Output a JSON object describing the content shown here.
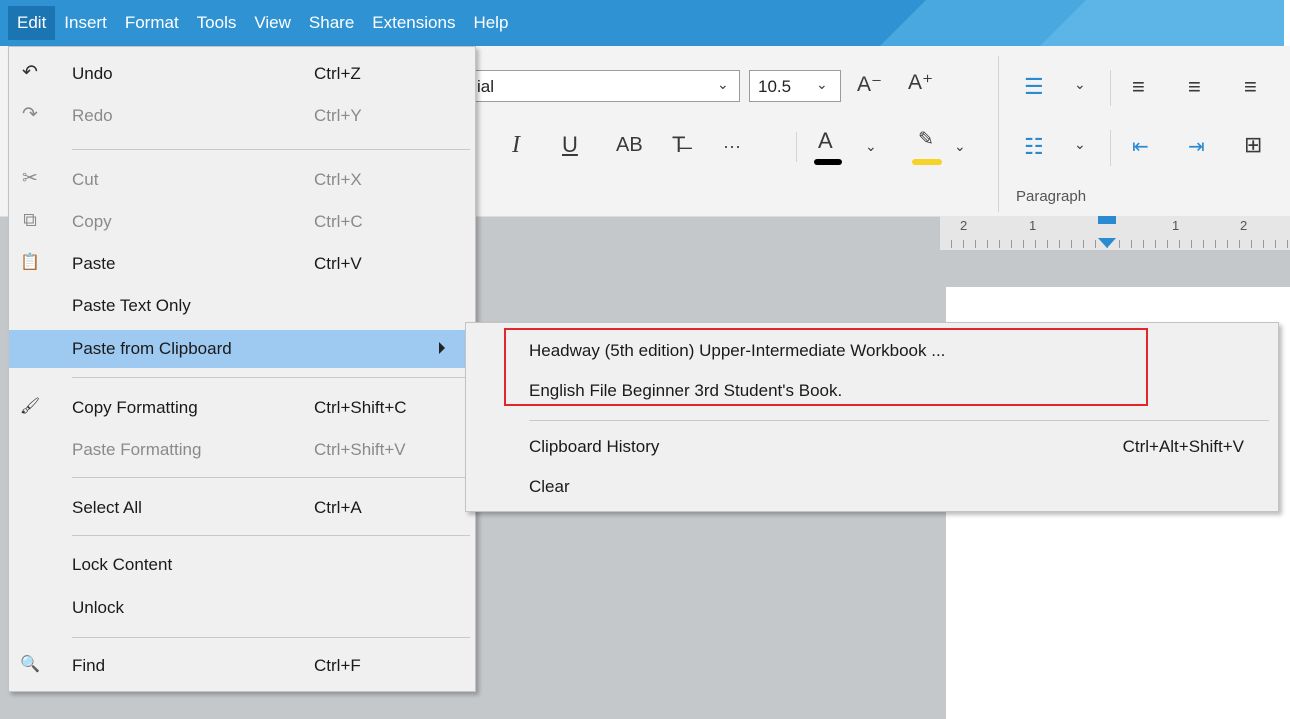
{
  "menubar": {
    "items": [
      "Edit",
      "Insert",
      "Format",
      "Tools",
      "View",
      "Share",
      "Extensions",
      "Help"
    ],
    "active": "Edit"
  },
  "ribbon": {
    "font_name_partial": "ial",
    "font_size": "10.5",
    "paragraph_label": "Paragraph",
    "more_label": "···",
    "text_marks": [
      "I",
      "U",
      "AB"
    ],
    "size_marks": [
      "A⁻",
      "A⁺"
    ],
    "highlight_color": "#f5d328",
    "font_color": "#000000"
  },
  "ruler": {
    "numbers": [
      "2",
      "1",
      "1",
      "2"
    ]
  },
  "edit_menu": {
    "items": [
      {
        "icon": "undo-icon",
        "glyph": "↶",
        "label": "Undo",
        "shortcut": "Ctrl+Z",
        "enabled": true
      },
      {
        "icon": "redo-icon",
        "glyph": "↷",
        "label": "Redo",
        "shortcut": "Ctrl+Y",
        "enabled": false
      },
      {
        "icon": "cut-icon",
        "glyph": "✂",
        "label": "Cut",
        "shortcut": "Ctrl+X",
        "enabled": false
      },
      {
        "icon": "copy-icon",
        "glyph": "⧉",
        "label": "Copy",
        "shortcut": "Ctrl+C",
        "enabled": false
      },
      {
        "icon": "paste-icon",
        "glyph": "📋",
        "label": "Paste",
        "shortcut": "Ctrl+V",
        "enabled": true
      },
      {
        "icon": "",
        "glyph": "",
        "label": "Paste Text Only",
        "shortcut": "",
        "enabled": true
      },
      {
        "icon": "",
        "glyph": "",
        "label": "Paste from Clipboard",
        "shortcut": "",
        "enabled": true,
        "submenu": true
      },
      {
        "icon": "copy-formatting-icon",
        "glyph": "🖌",
        "label": "Copy Formatting",
        "shortcut": "Ctrl+Shift+C",
        "enabled": true
      },
      {
        "icon": "",
        "glyph": "",
        "label": "Paste Formatting",
        "shortcut": "Ctrl+Shift+V",
        "enabled": false
      },
      {
        "icon": "",
        "glyph": "",
        "label": "Select All",
        "shortcut": "Ctrl+A",
        "enabled": true
      },
      {
        "icon": "",
        "glyph": "",
        "label": "Lock Content",
        "shortcut": "",
        "enabled": true
      },
      {
        "icon": "",
        "glyph": "",
        "label": "Unlock",
        "shortcut": "",
        "enabled": true
      },
      {
        "icon": "find-icon",
        "glyph": "🔍",
        "label": "Find",
        "shortcut": "Ctrl+F",
        "enabled": true
      }
    ]
  },
  "clipboard_submenu": {
    "entries": [
      "Headway (5th edition) Upper-Intermediate Workbook ...",
      "English File Beginner 3rd Student's Book."
    ],
    "history_label": "Clipboard History",
    "history_shortcut": "Ctrl+Alt+Shift+V",
    "clear_label": "Clear"
  },
  "colors": {
    "menubar": "#2e92d3",
    "menu_hover": "#9ec9f1",
    "highlight_border": "#e3262b"
  }
}
